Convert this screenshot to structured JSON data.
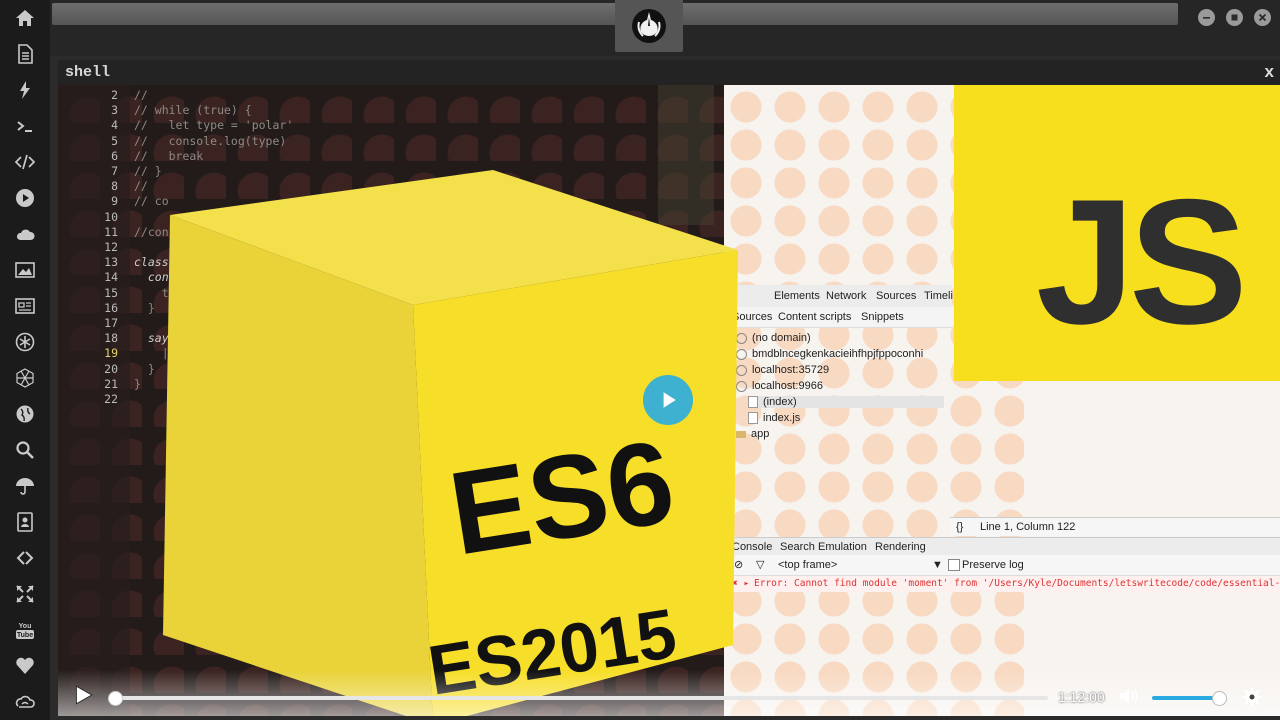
{
  "sidebar": {
    "items": [
      {
        "icon": "home-icon"
      },
      {
        "icon": "document-icon"
      },
      {
        "icon": "lightning-icon"
      },
      {
        "icon": "terminal-icon"
      },
      {
        "icon": "code-icon"
      },
      {
        "icon": "play-circle-icon"
      },
      {
        "icon": "cloud-icon"
      },
      {
        "icon": "image-icon"
      },
      {
        "icon": "newspaper-icon"
      },
      {
        "icon": "asterisk-icon"
      },
      {
        "icon": "hexagon-icon"
      },
      {
        "icon": "globe-icon"
      },
      {
        "icon": "search-icon"
      },
      {
        "icon": "umbrella-icon"
      },
      {
        "icon": "contact-book-icon"
      },
      {
        "icon": "link-icon"
      },
      {
        "icon": "expand-icon"
      },
      {
        "icon": "youtube-icon"
      },
      {
        "icon": "heart-icon"
      },
      {
        "icon": "infinity-cloud-icon"
      }
    ]
  },
  "window": {
    "logo": "rebel-alliance-icon",
    "buttons": [
      "minimize-icon",
      "maximize-icon",
      "close-icon"
    ]
  },
  "panel": {
    "title": "shell",
    "close_label": "x"
  },
  "video": {
    "editor_lines": [
      {
        "n": "2",
        "code": "//"
      },
      {
        "n": "3",
        "code": "// while (true) {"
      },
      {
        "n": "4",
        "code": "//   let type = 'polar'"
      },
      {
        "n": "5",
        "code": "//   console.log(type)"
      },
      {
        "n": "6",
        "code": "//   break"
      },
      {
        "n": "7",
        "code": "// }"
      },
      {
        "n": "8",
        "code": "//"
      },
      {
        "n": "9",
        "code": "// co"
      },
      {
        "n": "10",
        "code": ""
      },
      {
        "n": "11",
        "code": "//cons"
      },
      {
        "n": "12",
        "code": ""
      },
      {
        "n": "13",
        "code": "class"
      },
      {
        "n": "14",
        "code": "  cons"
      },
      {
        "n": "15",
        "code": "    t"
      },
      {
        "n": "16",
        "code": "  }"
      },
      {
        "n": "17",
        "code": ""
      },
      {
        "n": "18",
        "code": "  say"
      },
      {
        "n": "19",
        "code": "    |"
      },
      {
        "n": "20",
        "code": "  }"
      },
      {
        "n": "21",
        "code": "}"
      },
      {
        "n": "22",
        "code": ""
      }
    ],
    "cube_text_1": "ES6",
    "cube_text_2": "ES2015",
    "js_text": "JS",
    "devtools": {
      "tabs": [
        "Elements",
        "Network",
        "Sources",
        "Timeli"
      ],
      "subtabs": [
        "Sources",
        "Content scripts",
        "Snippets"
      ],
      "tree": [
        "(no domain)",
        "bmdblncegkenkacieihfhpjfppoconhi",
        "localhost:35729",
        "localhost:9966",
        "(index)",
        "index.js",
        "app"
      ],
      "status": "Line 1, Column 122",
      "console_tabs": [
        "Console",
        "Search",
        "Emulation",
        "Rendering"
      ],
      "frame_label": "<top frame>",
      "preserve_log": "Preserve log",
      "error_text": "Error: Cannot find module 'moment' from '/Users/Kyle/Documents/letswritecode/code/essential-es6"
    },
    "controls": {
      "time": "1:12:00",
      "progress": 0,
      "volume": 0.95
    }
  }
}
